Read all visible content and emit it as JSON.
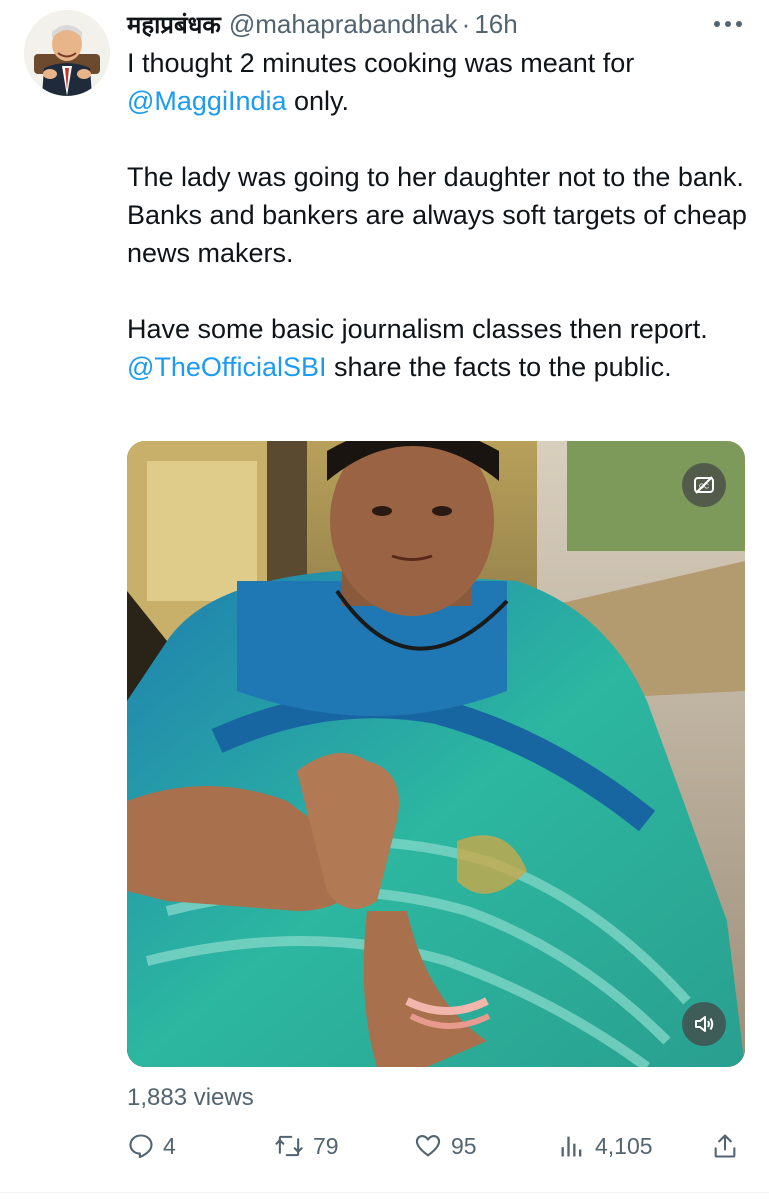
{
  "tweet": {
    "display_name": "महाप्रबंधक",
    "handle": "@mahaprabandhak",
    "separator": "·",
    "time": "16h",
    "text": {
      "p1_start": "I thought 2 minutes cooking was meant for ",
      "p1_mention": "@MaggiIndia",
      "p1_end": " only.",
      "p2": "The lady was going to her daughter not to the bank. Banks and bankers are always soft targets of cheap news makers.",
      "p3_start": "Have some basic journalism classes then report. ",
      "p3_mention": "@TheOfficialSBI",
      "p3_end": " share the facts to the public."
    },
    "views": "1,883 views",
    "stats": {
      "replies": "4",
      "retweets": "79",
      "likes": "95",
      "analytics": "4,105"
    }
  },
  "icons": {
    "more": "more-icon",
    "captions": "captions-off-icon",
    "volume": "volume-icon",
    "reply": "reply-icon",
    "retweet": "retweet-icon",
    "like": "heart-icon",
    "analytics": "analytics-icon",
    "share": "share-icon"
  },
  "colors": {
    "text": "#0f1419",
    "secondary": "#536471",
    "link": "#1d9bf0"
  }
}
